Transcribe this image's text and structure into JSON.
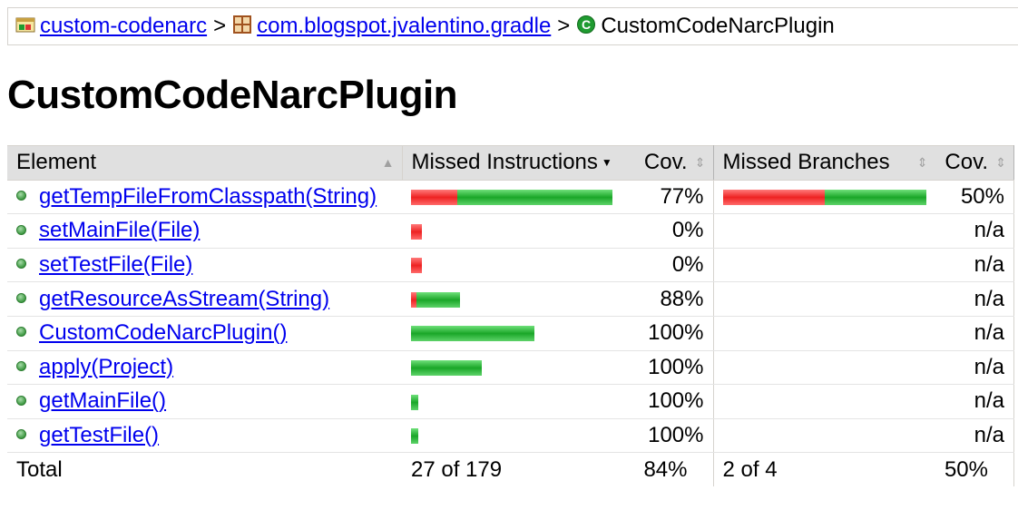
{
  "breadcrumb": {
    "report": "custom-codenarc",
    "package": "com.blogspot.jvalentino.gradle",
    "current": "CustomCodeNarcPlugin",
    "separator": ">"
  },
  "page": {
    "title": "CustomCodeNarcPlugin"
  },
  "table": {
    "headers": {
      "element": "Element",
      "missed_instructions": "Missed Instructions",
      "cov1": "Cov.",
      "missed_branches": "Missed Branches",
      "cov2": "Cov."
    },
    "rows": [
      {
        "name": "getTempFileFromClasspath(String)",
        "instr_missed_pct": 23,
        "instr_cov": "77%",
        "branch_missed_pct": 50,
        "branch_cov": "50%"
      },
      {
        "name": "setMainFile(File)",
        "instr_missed_pct": 100,
        "instr_cov": "0%",
        "branch_cov": "n/a"
      },
      {
        "name": "setTestFile(File)",
        "instr_missed_pct": 100,
        "instr_cov": "0%",
        "branch_cov": "n/a"
      },
      {
        "name": "getResourceAsStream(String)",
        "instr_missed_pct": 12,
        "instr_cov": "88%",
        "branch_cov": "n/a"
      },
      {
        "name": "CustomCodeNarcPlugin()",
        "instr_missed_pct": 0,
        "instr_cov": "100%",
        "branch_cov": "n/a"
      },
      {
        "name": "apply(Project)",
        "instr_missed_pct": 0,
        "instr_cov": "100%",
        "branch_cov": "n/a"
      },
      {
        "name": "getMainFile()",
        "instr_missed_pct": 0,
        "instr_cov": "100%",
        "branch_cov": "n/a"
      },
      {
        "name": "getTestFile()",
        "instr_missed_pct": 0,
        "instr_cov": "100%",
        "branch_cov": "n/a"
      }
    ],
    "total": {
      "label": "Total",
      "instr": "27 of 179",
      "instr_cov": "84%",
      "branch": "2 of 4",
      "branch_cov": "50%"
    }
  },
  "colors": {
    "missed": "#e22222",
    "covered": "#1aa628",
    "header_bg": "#e0e0e0",
    "link": "#0000ee"
  }
}
